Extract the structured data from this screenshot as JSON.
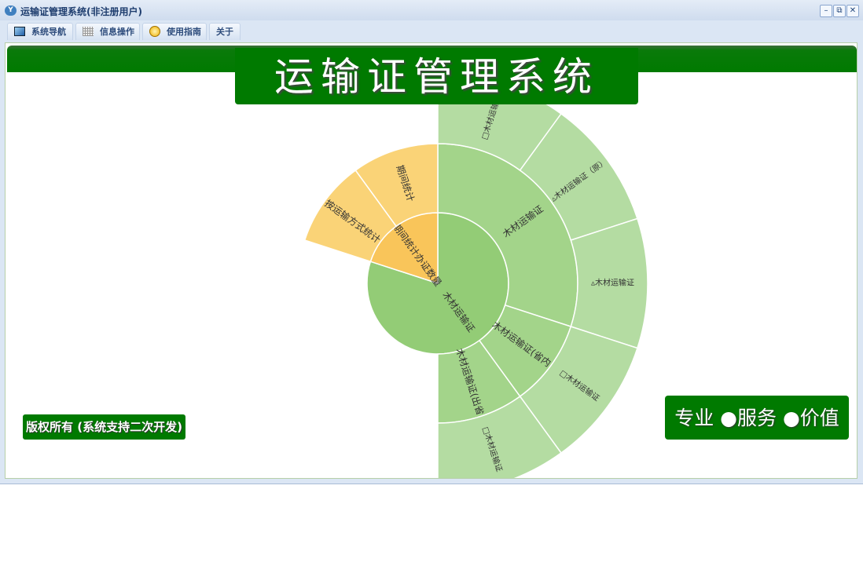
{
  "window": {
    "title": "运输证管理系统(非注册用户)",
    "app_icon": "Y",
    "controls": {
      "minimize": "–",
      "restore": "⧉",
      "close": "✕"
    }
  },
  "tabs": [
    {
      "label": "系统导航",
      "icon": "monitor-icon"
    },
    {
      "label": "信息操作",
      "icon": "grid-icon"
    },
    {
      "label": "使用指南",
      "icon": "help-icon"
    },
    {
      "label": "关于"
    }
  ],
  "main": {
    "banner_title": "运输证管理系统",
    "copyright": "版权所有 (系统支持二次开发)",
    "slogan": "专业 ●服务 ●价值"
  },
  "colors": {
    "banner_green": "#007a00",
    "green_l1": "#93cc76",
    "green_l2": "#a3d48a",
    "green_l3": "#b4dca2",
    "orange_l1": "#f9c55a",
    "orange_l2": "#fad377"
  },
  "chart_data": {
    "type": "sunburst",
    "start_angle": 90,
    "total": 10,
    "levels": [
      [
        {
          "name": "木材运输证",
          "value": 8,
          "color": "#93cc76"
        },
        {
          "name": "期间统计办证数量",
          "value": 2,
          "color": "#f9c55a"
        }
      ],
      [
        {
          "name": "木材运输证",
          "value": 3,
          "parent": 0,
          "color": "#a3d48a"
        },
        {
          "name": "木材运输证(省内)",
          "value": 1,
          "parent": 0,
          "color": "#a3d48a"
        },
        {
          "name": "木材运输证(出省)",
          "value": 1,
          "parent": 0,
          "color": "#a3d48a"
        },
        {
          "name": "gap",
          "value": 3,
          "parent": 0,
          "color": null
        },
        {
          "name": "按运输方式统计",
          "value": 1,
          "parent": 1,
          "color": "#fad377"
        },
        {
          "name": "期间统计",
          "value": 1,
          "parent": 1,
          "color": "#fad377"
        }
      ],
      [
        {
          "name": "□木材运输证",
          "value": 1,
          "color": "#b4dca2"
        },
        {
          "name": "▵木材运输证（原）",
          "value": 1,
          "color": "#b4dca2"
        },
        {
          "name": "▵木材运输证",
          "value": 1,
          "color": "#b4dca2"
        },
        {
          "name": "□木材运输证",
          "value": 1,
          "color": "#b4dca2"
        },
        {
          "name": "□木材运输证",
          "value": 1,
          "color": "#b4dca2"
        }
      ]
    ]
  }
}
